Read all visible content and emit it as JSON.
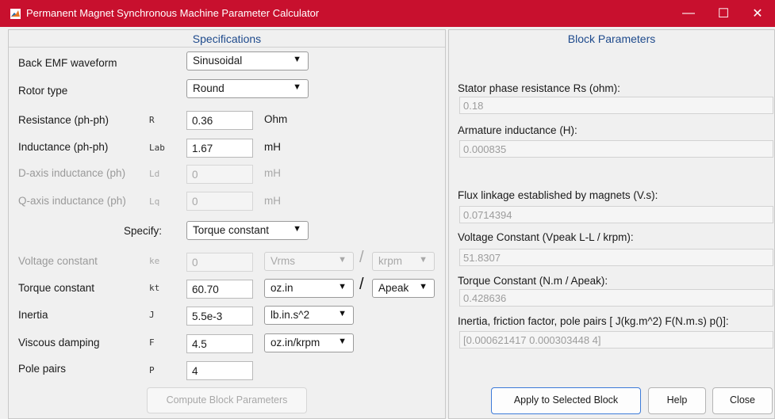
{
  "window": {
    "title": "Permanent Magnet Synchronous Machine Parameter Calculator",
    "min_icon": "minimize-icon",
    "max_icon": "maximize-icon",
    "close_icon": "close-icon",
    "titlebar_color": "#c8102e"
  },
  "specifications": {
    "heading": "Specifications",
    "back_emf": {
      "label": "Back EMF waveform",
      "value": "Sinusoidal"
    },
    "rotor_type": {
      "label": "Rotor type",
      "value": "Round"
    },
    "resistance": {
      "label": "Resistance (ph-ph)",
      "symbol": "R",
      "value": "0.36",
      "unit": "Ohm"
    },
    "inductance": {
      "label": "Inductance (ph-ph)",
      "symbol": "Lab",
      "value": "1.67",
      "unit": "mH"
    },
    "d_inductance": {
      "label": "D-axis inductance (ph)",
      "symbol": "Ld",
      "value": "0",
      "unit": "mH"
    },
    "q_inductance": {
      "label": "Q-axis inductance (ph)",
      "symbol": "Lq",
      "value": "0",
      "unit": "mH"
    },
    "specify": {
      "label": "Specify:",
      "value": "Torque constant"
    },
    "voltage_constant": {
      "label": "Voltage constant",
      "symbol": "ke",
      "value": "0",
      "unit1": "Vrms",
      "unit2": "krpm"
    },
    "torque_constant": {
      "label": "Torque constant",
      "symbol": "kt",
      "value": "60.70",
      "unit1": "oz.in",
      "unit2": "Apeak"
    },
    "inertia": {
      "label": "Inertia",
      "symbol": "J",
      "value": "5.5e-3",
      "unit": "lb.in.s^2"
    },
    "viscous_damping": {
      "label": "Viscous damping",
      "symbol": "F",
      "value": "4.5",
      "unit": "oz.in/krpm"
    },
    "pole_pairs": {
      "label": "Pole pairs",
      "symbol": "P",
      "value": "4"
    },
    "slash": "/",
    "compute_button": "Compute Block Parameters"
  },
  "block_parameters": {
    "heading": "Block Parameters",
    "rs": {
      "label": "Stator phase resistance Rs (ohm):",
      "value": "0.18"
    },
    "armature": {
      "label": "Armature inductance (H):",
      "value": "0.000835"
    },
    "flux": {
      "label": "Flux linkage established by magnets (V.s):",
      "value": "0.0714394"
    },
    "voltage_constant": {
      "label": "Voltage Constant (Vpeak L-L / krpm):",
      "value": "51.8307"
    },
    "torque_constant": {
      "label": "Torque Constant (N.m / Apeak):",
      "value": "0.428636"
    },
    "inertia_friction": {
      "label": "Inertia, friction factor, pole pairs [ J(kg.m^2)  F(N.m.s)  p()]:",
      "value": "[0.000621417 0.000303448 4]"
    },
    "apply_button": "Apply to Selected Block",
    "help_button": "Help",
    "close_button": "Close"
  },
  "glyphs": {
    "dropdown_arrow": "▼",
    "min": "—",
    "max": "☐",
    "close": "✕"
  }
}
